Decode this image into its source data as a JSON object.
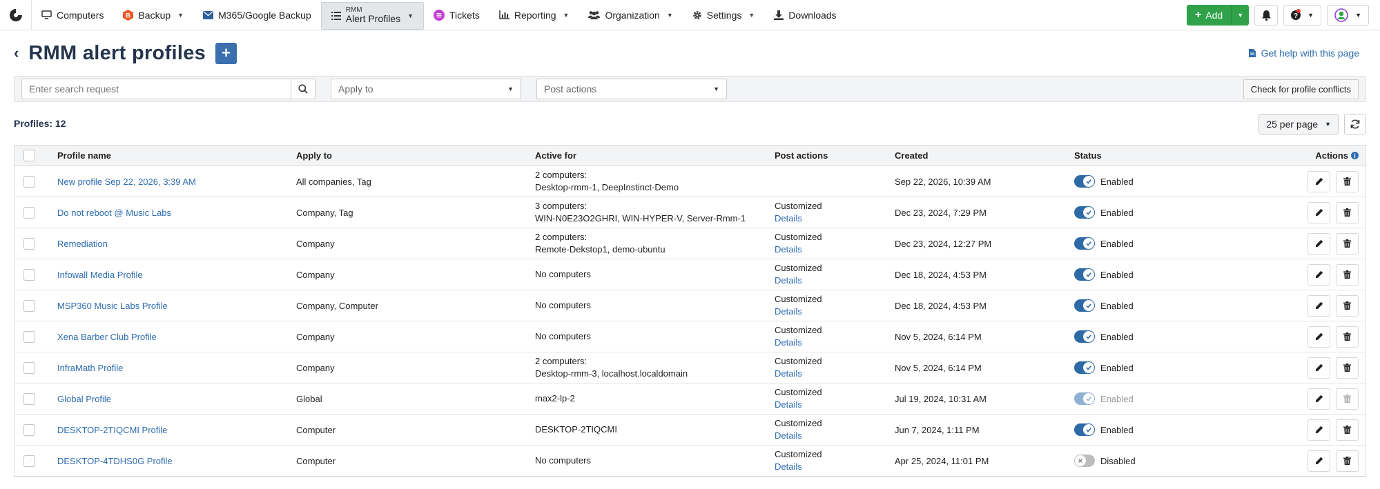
{
  "nav": {
    "items": [
      {
        "label": "Computers"
      },
      {
        "label": "Backup"
      },
      {
        "label": "M365/Google Backup"
      },
      {
        "label_small": "RMM",
        "label": "Alert Profiles"
      },
      {
        "label": "Tickets"
      },
      {
        "label": "Reporting"
      },
      {
        "label": "Organization"
      },
      {
        "label": "Settings"
      },
      {
        "label": "Downloads"
      }
    ],
    "add_label": "Add"
  },
  "header": {
    "title": "RMM alert profiles",
    "help_link": "Get help with this page"
  },
  "filters": {
    "search_placeholder": "Enter search request",
    "apply_to": "Apply to",
    "post_actions": "Post actions",
    "conflicts_button": "Check for profile conflicts"
  },
  "list": {
    "profiles_count": "Profiles: 12",
    "per_page": "25 per page"
  },
  "table": {
    "columns": [
      "Profile name",
      "Apply to",
      "Active for",
      "Post actions",
      "Created",
      "Status",
      "Actions"
    ],
    "details_label": "Details",
    "rows": [
      {
        "name": "New profile Sep 22, 2026, 3:39 AM",
        "apply_to": "All companies, Tag",
        "active_line1": "2 computers:",
        "active_line2": "Desktop-rmm-1, DeepInstinct-Demo",
        "post": "",
        "created": "Sep 22, 2026, 10:39 AM",
        "status": "Enabled"
      },
      {
        "name": "Do not reboot @ Music Labs",
        "apply_to": "Company, Tag",
        "active_line1": "3 computers:",
        "active_line2": "WIN-N0E23O2GHRI, WIN-HYPER-V, Server-Rmm-1",
        "post": "Customized",
        "created": "Dec 23, 2024, 7:29 PM",
        "status": "Enabled"
      },
      {
        "name": "Remediation",
        "apply_to": "Company",
        "active_line1": "2 computers:",
        "active_line2": "Remote-Dekstop1, demo-ubuntu",
        "post": "Customized",
        "created": "Dec 23, 2024, 12:27 PM",
        "status": "Enabled"
      },
      {
        "name": "Infowall Media Profile",
        "apply_to": "Company",
        "active_line1": "No computers",
        "active_line2": "",
        "post": "Customized",
        "created": "Dec 18, 2024, 4:53 PM",
        "status": "Enabled"
      },
      {
        "name": "MSP360 Music Labs Profile",
        "apply_to": "Company, Computer",
        "active_line1": "No computers",
        "active_line2": "",
        "post": "Customized",
        "created": "Dec 18, 2024, 4:53 PM",
        "status": "Enabled"
      },
      {
        "name": "Xena Barber Club Profile",
        "apply_to": "Company",
        "active_line1": "No computers",
        "active_line2": "",
        "post": "Customized",
        "created": "Nov 5, 2024, 6:14 PM",
        "status": "Enabled"
      },
      {
        "name": "InfraMath Profile",
        "apply_to": "Company",
        "active_line1": "2 computers:",
        "active_line2": "Desktop-rmm-3, localhost.localdomain",
        "post": "Customized",
        "created": "Nov 5, 2024, 6:14 PM",
        "status": "Enabled"
      },
      {
        "name": "Global Profile",
        "apply_to": "Global",
        "active_line1": "max2-lp-2",
        "active_line2": "",
        "post": "Customized",
        "created": "Jul 19, 2024, 10:31 AM",
        "status": "Enabled"
      },
      {
        "name": "DESKTOP-2TIQCMI Profile",
        "apply_to": "Computer",
        "active_line1": "DESKTOP-2TIQCMI",
        "active_line2": "",
        "post": "Customized",
        "created": "Jun 7, 2024, 1:11 PM",
        "status": "Enabled"
      },
      {
        "name": "DESKTOP-4TDHS0G Profile",
        "apply_to": "Computer",
        "active_line1": "No computers",
        "active_line2": "",
        "post": "Customized",
        "created": "Apr 25, 2024, 11:01 PM",
        "status": "Disabled"
      }
    ]
  }
}
